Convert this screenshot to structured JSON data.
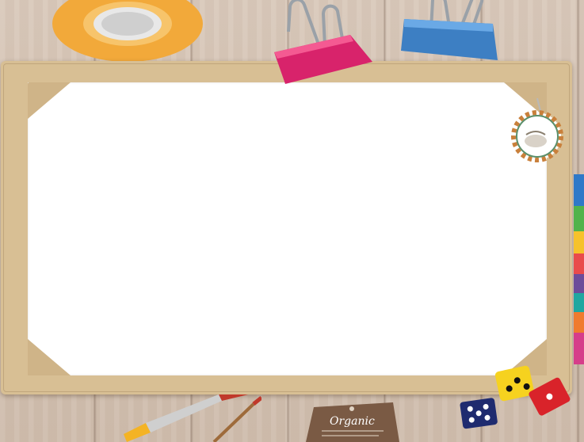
{
  "scene": {
    "frame_color": "#d8bf94",
    "canvas_color": "#ffffff",
    "wood_color": "#d4c2b2"
  },
  "decorations": {
    "tape_color": "#f2a93a",
    "pink_clip_color": "#d8236b",
    "blue_clip_color": "#3d7fc3",
    "tag_border_color": "#5b8f6a",
    "organic_tag": {
      "title": "Organic",
      "color": "#7a5a44"
    },
    "dice_colors": [
      "#f6d21f",
      "#d9232a",
      "#1f2b6f"
    ]
  }
}
